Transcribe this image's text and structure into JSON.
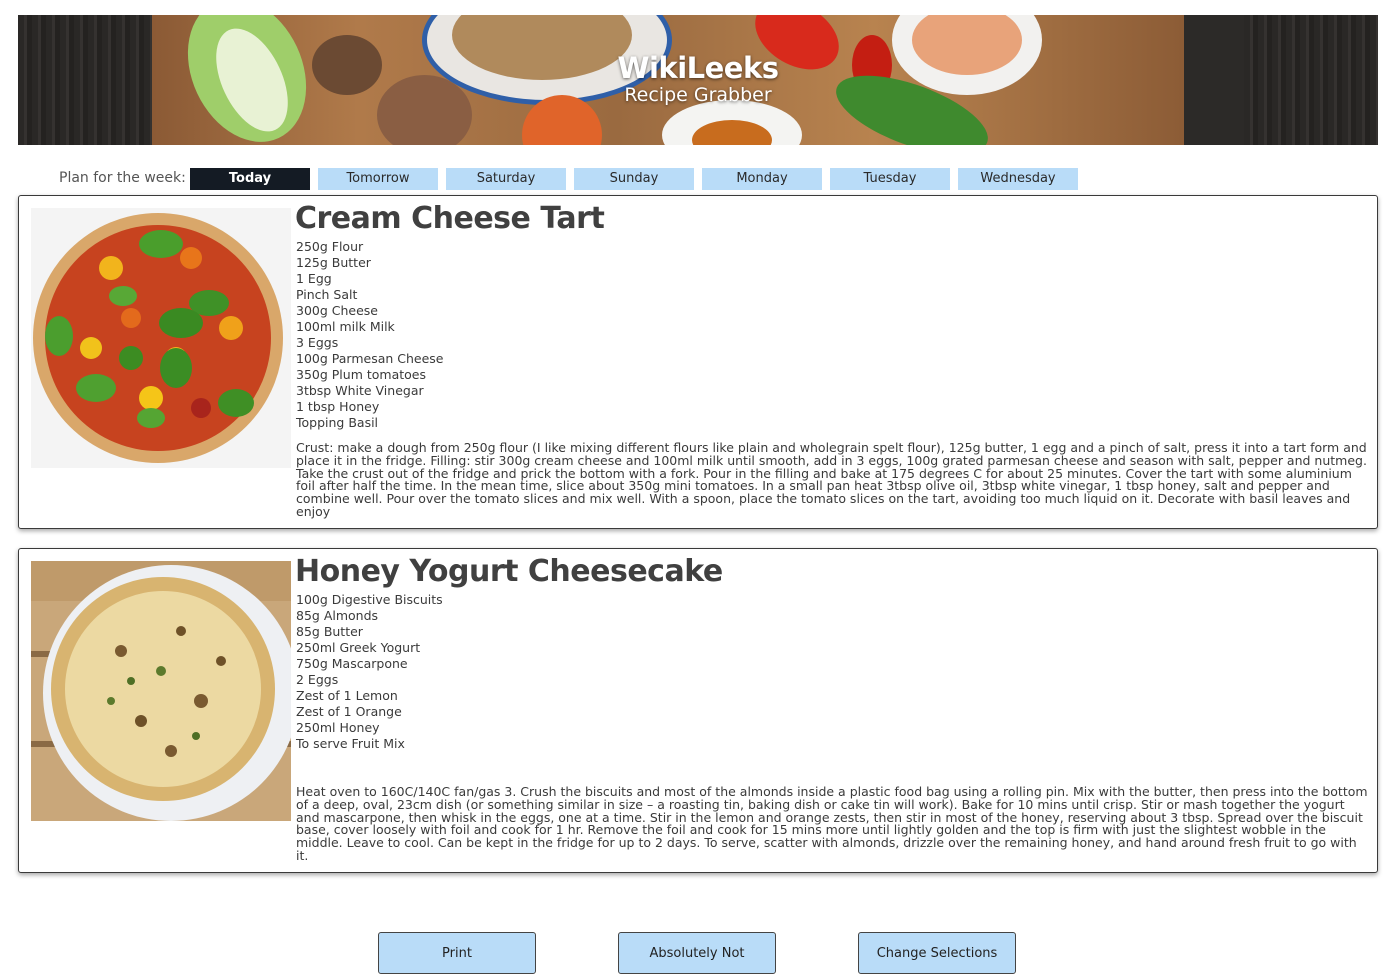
{
  "banner": {
    "title": "WikiLeeks",
    "subtitle": "Recipe Grabber"
  },
  "week": {
    "label": "Plan for the week:",
    "days": [
      "Today",
      "Tomorrow",
      "Saturday",
      "Sunday",
      "Monday",
      "Tuesday",
      "Wednesday"
    ],
    "active": "Today"
  },
  "recipes": [
    {
      "title": "Cream Cheese Tart",
      "ingredients": [
        "250g Flour",
        "125g Butter",
        "1 Egg",
        "Pinch Salt",
        "300g Cheese",
        "100ml milk Milk",
        "3 Eggs",
        "100g Parmesan Cheese",
        "350g Plum tomatoes",
        "3tbsp White Vinegar",
        "1 tbsp Honey",
        "Topping Basil"
      ],
      "method": "Crust: make a dough from 250g flour (I like mixing different flours like plain and wholegrain spelt flour), 125g butter, 1 egg and a pinch of salt, press it into a tart form and place it in the fridge. Filling: stir 300g cream cheese and 100ml milk until smooth, add in 3 eggs, 100g grated parmesan cheese and season with salt, pepper and nutmeg. Take the crust out of the fridge and prick the bottom with a fork. Pour in the filling and bake at 175 degrees C for about 25 minutes. Cover the tart with some aluminium foil after half the time. In the mean time, slice about 350g mini tomatoes. In a small pan heat 3tbsp olive oil, 3tbsp white vinegar, 1 tbsp honey, salt and pepper and combine well. Pour over the tomato slices and mix well. With a spoon, place the tomato slices on the tart, avoiding too much liquid on it. Decorate with basil leaves and enjoy"
    },
    {
      "title": "Honey Yogurt Cheesecake",
      "ingredients": [
        "100g Digestive Biscuits",
        "85g Almonds",
        "85g Butter",
        "250ml Greek Yogurt",
        "750g Mascarpone",
        "2 Eggs",
        "Zest of 1 Lemon",
        "Zest of 1 Orange",
        "250ml Honey",
        "To serve Fruit Mix"
      ],
      "method": "Heat oven to 160C/140C fan/gas 3. Crush the biscuits and most of the almonds inside a plastic food bag using a rolling pin. Mix with the butter, then press into the bottom of a deep, oval, 23cm dish (or something similar in size – a roasting tin, baking dish or cake tin will work). Bake for 10 mins until crisp. Stir or mash together the yogurt and mascarpone, then whisk in the eggs, one at a time. Stir in the lemon and orange zests, then stir in most of the honey, reserving about 3 tbsp. Spread over the biscuit base, cover loosely with foil and cook for 1 hr. Remove the foil and cook for 15 mins more until lightly golden and the top is firm with just the slightest wobble in the middle. Leave to cool. Can be kept in the fridge for up to 2 days. To serve, scatter with almonds, drizzle over the remaining honey, and hand around fresh fruit to go with it."
    }
  ],
  "actions": {
    "print": "Print",
    "reject": "Absolutely Not",
    "change": "Change Selections"
  }
}
